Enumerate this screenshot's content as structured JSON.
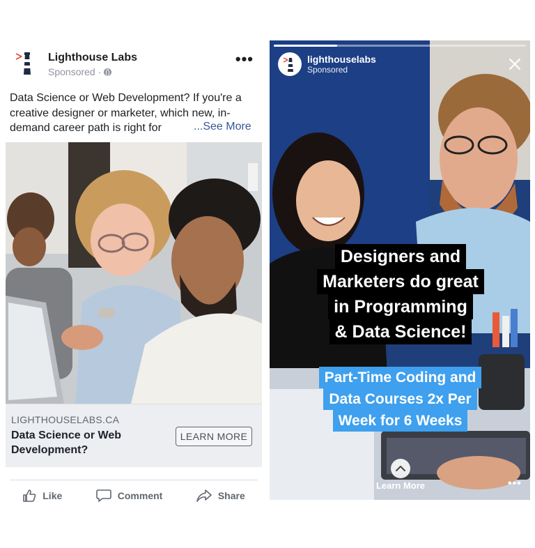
{
  "facebook_ad": {
    "page_name": "Lighthouse Labs",
    "sponsored_label": "Sponsored ·",
    "menu_icon": "more-horizontal-icon",
    "body_text": "Data Science or Web Development? If you're a creative designer or marketer, which new, in-demand career path is right for",
    "see_more": "...See More",
    "link_domain": "LIGHTHOUSELABS.CA",
    "link_headline": "Data Science or Web Development?",
    "cta_label": "LEARN MORE",
    "actions": [
      {
        "label": "Like",
        "icon": "thumbs-up-icon"
      },
      {
        "label": "Comment",
        "icon": "comment-icon"
      },
      {
        "label": "Share",
        "icon": "share-icon"
      }
    ]
  },
  "instagram_story": {
    "account_name": "lighthouselabs",
    "sponsored_label": "Sponsored",
    "progress": 0.25,
    "headline_lines": [
      "Designers and",
      "Marketers do great",
      "in Programming",
      "& Data Science!"
    ],
    "subheadline_lines": [
      "Part-Time Coding and",
      "Data Courses 2x Per",
      "Week for 6 Weeks"
    ],
    "cta_label": "Learn More",
    "close_icon": "close-icon",
    "swipe_icon": "chevron-up-icon",
    "menu_icon": "more-horizontal-icon"
  },
  "colors": {
    "facebook_link_blue": "#385898",
    "story_subheadline_bg": "#3ea0ee",
    "story_headline_bg": "#000000"
  }
}
